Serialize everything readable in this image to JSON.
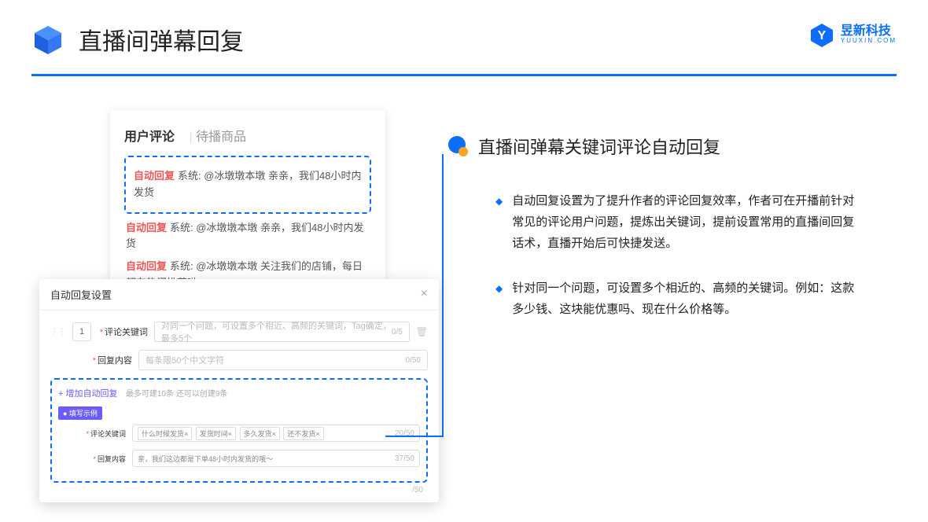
{
  "header": {
    "title": "直播间弹幕回复"
  },
  "brand": {
    "cn": "昱新科技",
    "en": "YUUXIN.COM"
  },
  "panel1": {
    "tab_active": "用户评论",
    "tab_inactive": "待播商品",
    "badge": "自动回复",
    "line1": "系统: @冰墩墩本墩 亲亲，我们48小时内发货",
    "line2": "系统: @冰墩墩本墩 亲亲，我们48小时内发货",
    "line3": "系统: @冰墩墩本墩 关注我们的店铺，每日都有热门推荐呦～"
  },
  "panel2": {
    "title": "自动回复设置",
    "order": "1",
    "field1_label": "评论关键词",
    "field1_placeholder": "对同一个问题，可设置多个相近、高频的关键词，Tag确定，最多5个",
    "field1_count": "0/5",
    "field2_label": "回复内容",
    "field2_placeholder": "每条限50个中文字符",
    "field2_count": "0/50",
    "add_link": "+ 增加自动回复",
    "add_hint": "最多可建10条 还可以创建9条",
    "example_badge": "● 填写示例",
    "ex_field1_label": "评论关键词",
    "ex_tags": [
      "什么时候发货×",
      "发货时间×",
      "多久发货×",
      "还不发货×"
    ],
    "ex_field1_count": "20/50",
    "ex_field2_label": "回复内容",
    "ex_field2_value": "亲，我们这边都是下单48小时内发货的哦～",
    "ex_field2_count": "37/50",
    "outer_count": "/50"
  },
  "right": {
    "subtitle": "直播间弹幕关键词评论自动回复",
    "p1": "自动回复设置为了提升作者的评论回复效率，作者可在开播前针对常见的评论用户问题，提炼出关键词，提前设置常用的直播间回复话术，直播开始后可快捷发送。",
    "p2": "针对同一个问题，可设置多个相近的、高频的关键词。例如：这款多少钱、这块能优惠吗、现在什么价格等。"
  }
}
